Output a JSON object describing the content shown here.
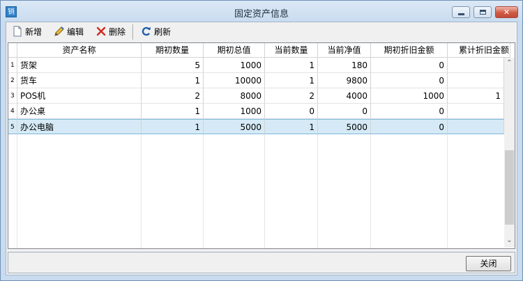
{
  "window": {
    "title": "固定资产信息",
    "app_icon_text": "销"
  },
  "toolbar": {
    "new_label": "新增",
    "edit_label": "编辑",
    "delete_label": "删除",
    "refresh_label": "刷新"
  },
  "table": {
    "columns": [
      "资产名称",
      "期初数量",
      "期初总值",
      "当前数量",
      "当前净值",
      "期初折旧金额",
      "累计折旧金额"
    ],
    "rows": [
      {
        "num": "1",
        "name": "货架",
        "init_qty": "5",
        "init_total": "1000",
        "cur_qty": "1",
        "cur_net": "180",
        "init_depr": "0",
        "accum_depr": ""
      },
      {
        "num": "2",
        "name": "货车",
        "init_qty": "1",
        "init_total": "10000",
        "cur_qty": "1",
        "cur_net": "9800",
        "init_depr": "0",
        "accum_depr": ""
      },
      {
        "num": "3",
        "name": "POS机",
        "init_qty": "2",
        "init_total": "8000",
        "cur_qty": "2",
        "cur_net": "4000",
        "init_depr": "1000",
        "accum_depr": "1"
      },
      {
        "num": "4",
        "name": "办公桌",
        "init_qty": "1",
        "init_total": "1000",
        "cur_qty": "0",
        "cur_net": "0",
        "init_depr": "0",
        "accum_depr": ""
      },
      {
        "num": "5",
        "name": "办公电脑",
        "init_qty": "1",
        "init_total": "5000",
        "cur_qty": "1",
        "cur_net": "5000",
        "init_depr": "0",
        "accum_depr": ""
      }
    ],
    "selected_row": 5
  },
  "footer": {
    "close_label": "关闭"
  },
  "colors": {
    "selection": "#d5eaf6",
    "close_button": "#c24a39",
    "title_bar": "#c9dcef"
  },
  "icons": {
    "new": "new-document-icon",
    "edit": "pencil-icon",
    "delete": "red-x-icon",
    "refresh": "refresh-icon"
  }
}
